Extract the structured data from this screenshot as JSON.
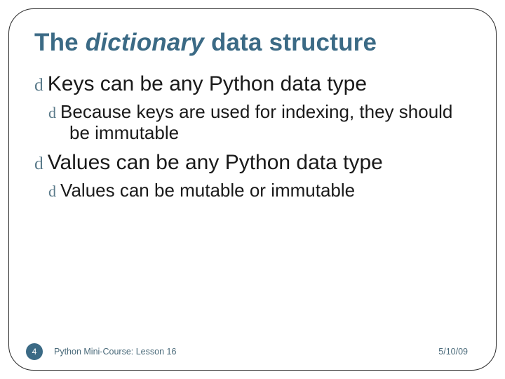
{
  "title_pre": "The ",
  "title_em": "dictionary",
  "title_post": " data structure",
  "bullets": {
    "b1": "Keys can be any Python data type",
    "b1a": "Because keys are used for indexing, they should be immutable",
    "b2": "Values can be any Python data type",
    "b2a": "Values can be mutable or immutable"
  },
  "footer": {
    "slide_number": "4",
    "course": "Python Mini-Course: Lesson 16",
    "date": "5/10/09"
  },
  "glyph": "d"
}
